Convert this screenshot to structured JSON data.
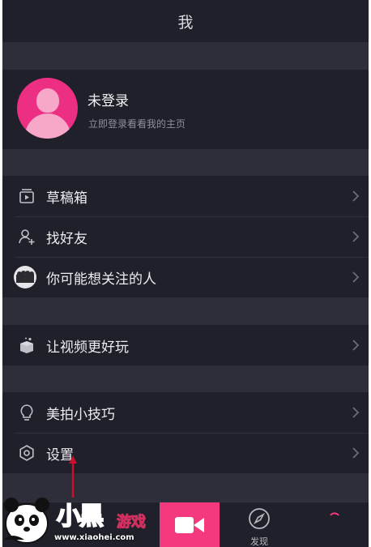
{
  "header": {
    "title": "我"
  },
  "profile": {
    "name": "未登录",
    "subtitle": "立即登录看看我的主页"
  },
  "menu_group_1": [
    {
      "label": "草稿箱",
      "icon": "drafts-icon"
    },
    {
      "label": "找好友",
      "icon": "add-friend-icon"
    },
    {
      "label": "你可能想关注的人",
      "icon": "suggested-people-icon"
    }
  ],
  "menu_group_2": [
    {
      "label": "让视频更好玩",
      "icon": "magic-box-icon"
    }
  ],
  "menu_group_3": [
    {
      "label": "美拍小技巧",
      "icon": "lightbulb-icon"
    },
    {
      "label": "设置",
      "icon": "settings-gear-icon"
    }
  ],
  "bottom_nav": {
    "discover_label": "发现"
  },
  "watermark": {
    "brand": "小黑",
    "brand2": "游戏",
    "site": "www.xiaohei.com"
  },
  "colors": {
    "accent": "#f5397f",
    "avatar": "#ec2f83",
    "background": "#1f2029",
    "separator": "#2d2e39",
    "annotation_arrow": "#c8102e"
  }
}
